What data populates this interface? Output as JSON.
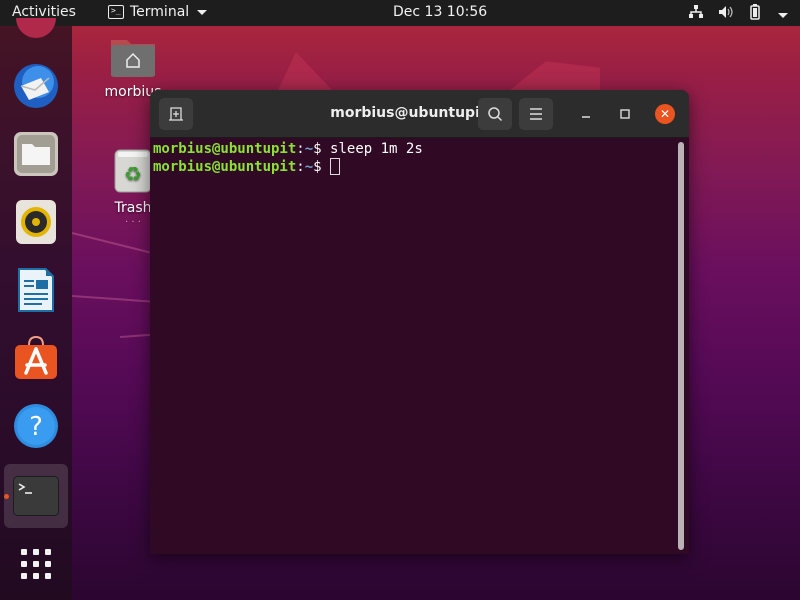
{
  "topbar": {
    "activities": "Activities",
    "app_menu_label": "Terminal",
    "app_menu_icon": "terminal-icon",
    "clock": "Dec 13  10:56",
    "tray_icons": [
      "network-icon",
      "volume-icon",
      "battery-icon",
      "system-menu-chevron-icon"
    ]
  },
  "dock": {
    "items": [
      {
        "name": "thunderbird",
        "icon": "thunderbird-mail-icon"
      },
      {
        "name": "files",
        "icon": "files-folder-icon"
      },
      {
        "name": "rhythmbox",
        "icon": "rhythmbox-speaker-icon"
      },
      {
        "name": "libreoffice-writer",
        "icon": "writer-document-icon"
      },
      {
        "name": "ubuntu-software",
        "icon": "software-store-icon"
      },
      {
        "name": "help",
        "icon": "help-icon"
      },
      {
        "name": "terminal",
        "icon": "terminal-icon",
        "running": true,
        "active": true
      },
      {
        "name": "show-applications",
        "icon": "app-grid-icon"
      }
    ],
    "accent": "#e95420"
  },
  "desktop": {
    "icons": [
      {
        "label": "morbius",
        "icon": "home-folder-icon"
      },
      {
        "label": "Trash",
        "icon": "trash-icon"
      }
    ]
  },
  "window": {
    "title": "morbius@ubuntupit: ~",
    "new_tab_glyph": "⊞",
    "search_glyph": "⌕",
    "menu_glyph": "≡",
    "minimize_glyph": "–",
    "maximize_glyph": "□",
    "close_glyph": "✕",
    "terminal": {
      "lines": [
        {
          "user": "morbius@ubuntupit",
          "sep": ":",
          "path": "~",
          "symbol": "$ ",
          "command": "sleep 1m 2s"
        },
        {
          "user": "morbius@ubuntupit",
          "sep": ":",
          "path": "~",
          "symbol": "$ ",
          "command": ""
        }
      ],
      "colors": {
        "background": "#300a24",
        "user": "#8ae234",
        "path": "#729fcf",
        "text": "#ffffff"
      }
    }
  }
}
